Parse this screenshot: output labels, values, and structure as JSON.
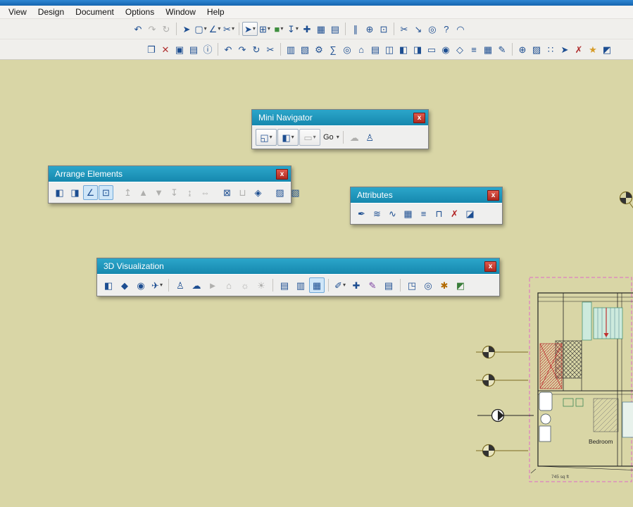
{
  "ui": {
    "caret_glyph": "▾",
    "close_glyph": "x"
  },
  "menubar": {
    "items": [
      {
        "name": "menu-view",
        "label": "View"
      },
      {
        "name": "menu-design",
        "label": "Design"
      },
      {
        "name": "menu-document",
        "label": "Document"
      },
      {
        "name": "menu-options",
        "label": "Options"
      },
      {
        "name": "menu-window",
        "label": "Window"
      },
      {
        "name": "menu-help",
        "label": "Help"
      }
    ]
  },
  "toolbar_top": {
    "icons": [
      {
        "name": "undo-icon",
        "glyph": "↶"
      },
      {
        "name": "redo-icon",
        "glyph": "↷",
        "disabled": true
      },
      {
        "name": "repeat-icon",
        "glyph": "↻",
        "disabled": true
      },
      {
        "type": "sep"
      },
      {
        "name": "find-select-icon",
        "glyph": "➤"
      },
      {
        "name": "marquee-tool-icon",
        "glyph": "▢",
        "dd": true
      },
      {
        "name": "guide-lines-icon",
        "glyph": "∠",
        "dd": true
      },
      {
        "name": "snap-guides-icon",
        "glyph": "✂",
        "dd": true
      },
      {
        "type": "sep"
      },
      {
        "name": "arrow-tool-icon",
        "glyph": "➤",
        "boxed": true,
        "dd": true
      },
      {
        "name": "snap-grid-icon",
        "glyph": "⊞",
        "dd": true
      },
      {
        "name": "solid-editing-icon",
        "glyph": "■",
        "color": "#3f8f3f",
        "dd": true
      },
      {
        "name": "gravity-icon",
        "glyph": "↧",
        "dd": true
      },
      {
        "name": "magic-wand-icon",
        "glyph": "✚"
      },
      {
        "name": "element-information-icon",
        "glyph": "▦"
      },
      {
        "name": "dimension-style-icon",
        "glyph": "▤"
      },
      {
        "type": "sep"
      },
      {
        "name": "column-grid-icon",
        "glyph": "∥"
      },
      {
        "name": "zoom-in-icon",
        "glyph": "⊕"
      },
      {
        "name": "fit-in-window-icon",
        "glyph": "⊡"
      },
      {
        "type": "sep"
      },
      {
        "name": "split-icon",
        "glyph": "✂"
      },
      {
        "name": "adjust-icon",
        "glyph": "↘"
      },
      {
        "name": "hotspot-icon",
        "glyph": "◎"
      },
      {
        "name": "help-pointer-icon",
        "glyph": "?"
      },
      {
        "name": "arc-tool-icon",
        "glyph": "◠"
      }
    ]
  },
  "toolbar_std": {
    "icons": [
      {
        "name": "open-icon",
        "glyph": "❐"
      },
      {
        "name": "delete-icon",
        "glyph": "✕",
        "color": "#b03030"
      },
      {
        "name": "save-icon",
        "glyph": "▣"
      },
      {
        "name": "print-icon",
        "glyph": "▤"
      },
      {
        "name": "info-icon",
        "glyph": "ⓘ"
      },
      {
        "type": "sep"
      },
      {
        "name": "undo-icon",
        "glyph": "↶"
      },
      {
        "name": "redo-icon",
        "glyph": "↷"
      },
      {
        "name": "rebuild-icon",
        "glyph": "↻"
      },
      {
        "name": "cut-icon",
        "glyph": "✂"
      },
      {
        "type": "sep"
      },
      {
        "name": "copy-icon",
        "glyph": "▥"
      },
      {
        "name": "paste-icon",
        "glyph": "▧"
      },
      {
        "name": "element-settings-icon",
        "glyph": "⚙"
      },
      {
        "name": "quantities-icon",
        "glyph": "∑"
      },
      {
        "name": "find-select-icon",
        "glyph": "◎"
      },
      {
        "name": "story-up-icon",
        "glyph": "⌂"
      },
      {
        "name": "story-settings-icon",
        "glyph": "▤"
      },
      {
        "name": "section-icon",
        "glyph": "◫"
      },
      {
        "name": "elevation-icon",
        "glyph": "◧"
      },
      {
        "name": "interior-elevation-icon",
        "glyph": "◨"
      },
      {
        "name": "worksheet-icon",
        "glyph": "▭"
      },
      {
        "name": "detail-icon",
        "glyph": "◉"
      },
      {
        "name": "3d-document-icon",
        "glyph": "◇"
      },
      {
        "name": "schedule-icon",
        "glyph": "≡"
      },
      {
        "name": "layout-book-icon",
        "glyph": "▦"
      },
      {
        "name": "drawing-icon",
        "glyph": "✎"
      },
      {
        "type": "sep"
      },
      {
        "name": "zoom-icon",
        "glyph": "⊕"
      },
      {
        "name": "library-manager-icon",
        "glyph": "▨"
      },
      {
        "name": "organizer-icon",
        "glyph": "∷"
      },
      {
        "name": "publisher-icon",
        "glyph": "➤"
      },
      {
        "name": "markup-icon",
        "glyph": "✗",
        "color": "#b03030"
      },
      {
        "name": "favorites-icon",
        "glyph": "★",
        "color": "#d79c28"
      },
      {
        "name": "graphic-override-icon",
        "glyph": "◩"
      }
    ]
  },
  "palettes": {
    "mini_navigator": {
      "title": "Mini Navigator",
      "icons": [
        {
          "name": "project-map-button",
          "glyph": "◱",
          "boxed": true,
          "active": true,
          "dd": true
        },
        {
          "name": "view-map-button",
          "glyph": "◧",
          "boxed": true,
          "dd": true
        },
        {
          "name": "layout-book-button",
          "glyph": "▭",
          "boxed": true,
          "disabled": true,
          "dd": true
        },
        {
          "name": "go-button",
          "label": "Go",
          "dd": true
        },
        {
          "type": "sep"
        },
        {
          "name": "comment-bubble-icon",
          "glyph": "☁",
          "disabled": true
        },
        {
          "name": "walk-mode-icon",
          "glyph": "♙"
        }
      ]
    },
    "arrange_elements": {
      "title": "Arrange Elements",
      "icons": [
        {
          "name": "align-left-edges-icon",
          "glyph": "◧"
        },
        {
          "name": "align-right-edges-icon",
          "glyph": "◨"
        },
        {
          "name": "align-angle-icon",
          "glyph": "∠",
          "active": true
        },
        {
          "name": "align-special-icon",
          "glyph": "⊡",
          "active": true
        },
        {
          "type": "sep"
        },
        {
          "name": "align-top-icon",
          "glyph": "↥",
          "disabled": true
        },
        {
          "name": "move-up-icon",
          "glyph": "▲",
          "disabled": true
        },
        {
          "name": "move-down-icon",
          "glyph": "▼",
          "disabled": true
        },
        {
          "name": "align-bottom-icon",
          "glyph": "↧",
          "disabled": true
        },
        {
          "name": "distribute-vertical-icon",
          "glyph": "↨",
          "disabled": true
        },
        {
          "name": "distribute-horizontal-icon",
          "glyph": "⇔",
          "disabled": true
        },
        {
          "type": "sep"
        },
        {
          "name": "lock-icon",
          "glyph": "⊠"
        },
        {
          "name": "unlock-icon",
          "glyph": "⊔",
          "disabled": true
        },
        {
          "name": "group-icon",
          "glyph": "◈"
        },
        {
          "type": "sep"
        },
        {
          "name": "bring-forward-icon",
          "glyph": "▨"
        },
        {
          "name": "send-backward-icon",
          "glyph": "▧"
        }
      ]
    },
    "attributes": {
      "title": "Attributes",
      "icons": [
        {
          "name": "pen-color-icon",
          "glyph": "✒"
        },
        {
          "name": "layer-settings-icon",
          "glyph": "≋"
        },
        {
          "name": "line-type-icon",
          "glyph": "∿"
        },
        {
          "name": "fill-type-icon",
          "glyph": "▦"
        },
        {
          "name": "composite-structure-icon",
          "glyph": "≡"
        },
        {
          "name": "profile-manager-icon",
          "glyph": "⊓"
        },
        {
          "name": "markup-pen-icon",
          "glyph": "✗",
          "color": "#b22222"
        },
        {
          "name": "building-material-icon",
          "glyph": "◪"
        }
      ]
    },
    "three_d": {
      "title": "3D Visualization",
      "icons": [
        {
          "name": "3d-view-settings-icon",
          "glyph": "◧"
        },
        {
          "name": "3d-block-icon",
          "glyph": "◆"
        },
        {
          "name": "perspective-camera-icon",
          "glyph": "◉"
        },
        {
          "name": "fly-mode-icon",
          "glyph": "✈",
          "dd": true
        },
        {
          "type": "sep"
        },
        {
          "name": "walk-icon",
          "glyph": "♙"
        },
        {
          "name": "talk-bubble-icon",
          "glyph": "☁"
        },
        {
          "name": "play-walkthrough-icon",
          "glyph": "►",
          "disabled": true
        },
        {
          "name": "home-view-icon",
          "glyph": "⌂",
          "disabled": true
        },
        {
          "name": "run-icon",
          "glyph": "☼",
          "disabled": true
        },
        {
          "name": "daylight-icon",
          "glyph": "☀",
          "disabled": true
        },
        {
          "type": "sep"
        },
        {
          "name": "copy-view-icon",
          "glyph": "▤"
        },
        {
          "name": "paste-view-icon",
          "glyph": "▥"
        },
        {
          "name": "clipboard-3d-icon",
          "glyph": "▦",
          "active": true
        },
        {
          "type": "sep"
        },
        {
          "name": "camera-path-icon",
          "glyph": "✐",
          "dd": true
        },
        {
          "name": "pin-icon",
          "glyph": "✚"
        },
        {
          "name": "surface-paint-icon",
          "glyph": "✎",
          "color": "#7b3fa0"
        },
        {
          "name": "image-note-icon",
          "glyph": "▤"
        },
        {
          "type": "sep"
        },
        {
          "name": "cutaway-icon",
          "glyph": "◳"
        },
        {
          "name": "snapshot-camera-icon",
          "glyph": "◎"
        },
        {
          "name": "render-settings-icon",
          "glyph": "✱",
          "color": "#b26a00"
        },
        {
          "name": "visualization-options-icon",
          "glyph": "◩",
          "color": "#3a7d3a"
        }
      ]
    }
  },
  "canvas": {
    "room_label": "Bedroom",
    "area_label": "745 sq ft"
  },
  "colors": {
    "canvas_bg": "#d9d6a6",
    "palette_title": "#1e9ec2",
    "close_red": "#c0392b",
    "boundary_magenta": "#e06ac8",
    "marker_olive": "#7a6b22",
    "icon_blue": "#1d4e91"
  }
}
